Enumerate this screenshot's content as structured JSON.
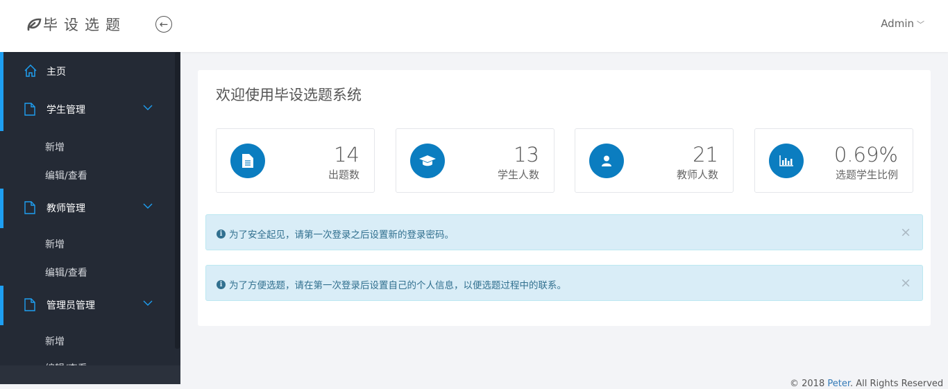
{
  "header": {
    "logo_text": "毕设选题",
    "user": "Admin"
  },
  "sidebar": {
    "items": [
      {
        "label": "主页",
        "icon": "home-icon"
      },
      {
        "label": "学生管理",
        "icon": "file-icon",
        "children": [
          "新增",
          "编辑/查看"
        ]
      },
      {
        "label": "教师管理",
        "icon": "file-icon",
        "children": [
          "新增",
          "编辑/查看"
        ]
      },
      {
        "label": "管理员管理",
        "icon": "file-icon",
        "children": [
          "新增",
          "编辑/查看"
        ]
      }
    ]
  },
  "main": {
    "title": "欢迎使用毕设选题系统",
    "stats": [
      {
        "value": "14",
        "label": "出题数",
        "icon": "document-icon"
      },
      {
        "value": "13",
        "label": "学生人数",
        "icon": "graduation-cap-icon"
      },
      {
        "value": "21",
        "label": "教师人数",
        "icon": "user-icon"
      },
      {
        "value": "0.69%",
        "label": "选题学生比例",
        "icon": "bar-chart-icon"
      }
    ],
    "alerts": [
      {
        "text": "为了安全起见，请第一次登录之后设置新的登录密码。",
        "close": "×"
      },
      {
        "text": "为了方便选题，请在第一次登录后设置自己的个人信息，以便选题过程中的联系。",
        "close": "×"
      }
    ]
  },
  "footer": {
    "prefix": "© 2018 ",
    "name": "Peter",
    "suffix": ". All Rights Reserved"
  },
  "colors": {
    "accent": "#0b7dc0",
    "sidebar": "#242a35",
    "active_bar": "#1e9ff2",
    "alert_bg": "#d9edf7"
  }
}
